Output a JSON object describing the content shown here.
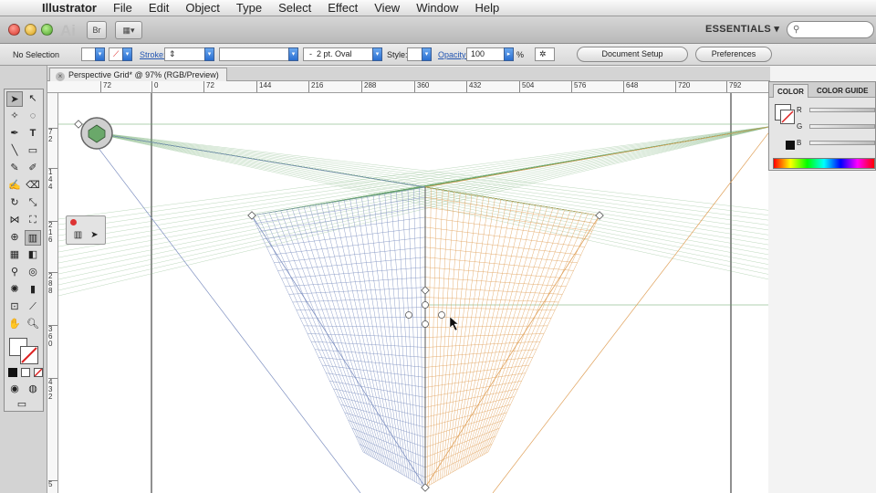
{
  "menubar": {
    "app_name": "Illustrator",
    "items": [
      "File",
      "Edit",
      "Object",
      "Type",
      "Select",
      "Effect",
      "View",
      "Window",
      "Help"
    ]
  },
  "appbar": {
    "logo": "Ai",
    "bridge_label": "Br",
    "workspace": "ESSENTIALS ▾",
    "search_placeholder": ""
  },
  "control_bar": {
    "selection": "No Selection",
    "stroke_label": "Stroke:",
    "brush": "2 pt. Oval",
    "style_label": "Style:",
    "opacity_label": "Opacity:",
    "opacity_value": "100",
    "percent": "%",
    "document_setup": "Document Setup",
    "preferences": "Preferences"
  },
  "document": {
    "tab_title": "Perspective Grid* @ 97% (RGB/Preview)"
  },
  "ruler": {
    "h_ticks": [
      "72",
      "0",
      "72",
      "144",
      "216",
      "288",
      "360",
      "432",
      "504",
      "576",
      "648",
      "720",
      "792"
    ],
    "v_ticks": [
      "7\n2",
      "1\n4\n4",
      "2\n1\n6",
      "2\n8\n8",
      "3\n6\n0",
      "4\n3\n2",
      "5"
    ]
  },
  "color_panel": {
    "tab_color": "COLOR",
    "tab_guide": "COLOR GUIDE",
    "r_label": "R",
    "g_label": "G",
    "b_label": "B"
  },
  "colors": {
    "grid_left": "#7d8fc0",
    "grid_right": "#e0a15a",
    "grid_floor": "#6aa86a",
    "selection": "#3a6fd6"
  }
}
